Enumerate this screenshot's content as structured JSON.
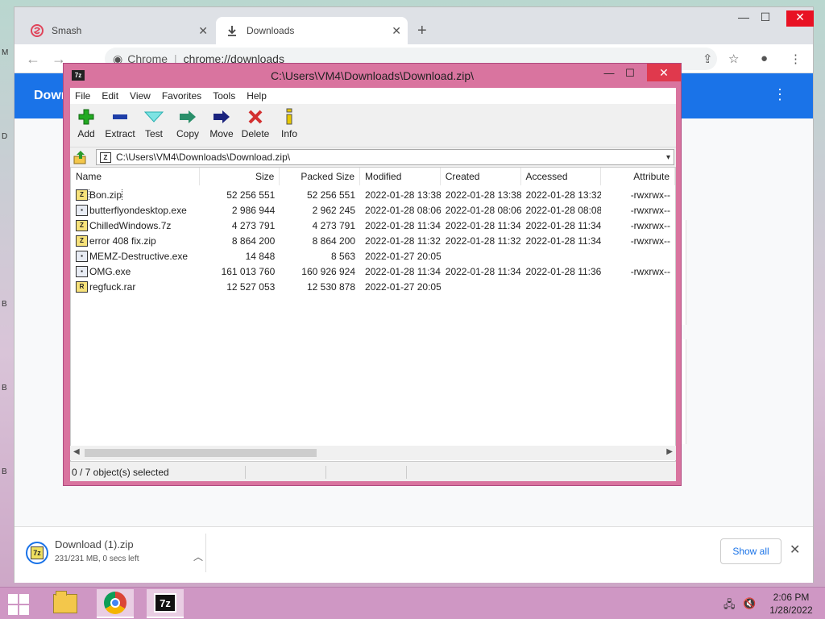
{
  "desktop": {
    "side_letters": [
      "M",
      "D",
      "B",
      "B",
      "B"
    ]
  },
  "browser": {
    "tabs": [
      {
        "label": "Smash",
        "icon": "smash-logo-icon"
      },
      {
        "label": "Downloads",
        "icon": "download-icon"
      }
    ],
    "omnibox": {
      "scheme_label": "Chrome",
      "url": "chrome://downloads"
    },
    "page_title": "Down",
    "shelf": {
      "filename": "Download (1).zip",
      "status": "231/231 MB, 0 secs left",
      "show_all_label": "Show all"
    }
  },
  "sevenzip": {
    "window_title": "C:\\Users\\VM4\\Downloads\\Download.zip\\",
    "menu": [
      "File",
      "Edit",
      "View",
      "Favorites",
      "Tools",
      "Help"
    ],
    "toolbar": [
      {
        "label": "Add",
        "icon": "plus-icon",
        "color": "#22aa22"
      },
      {
        "label": "Extract",
        "icon": "minus-icon",
        "color": "#1f3fa8"
      },
      {
        "label": "Test",
        "icon": "check-icon",
        "color": "#2ab0b0"
      },
      {
        "label": "Copy",
        "icon": "copy-arrow-icon",
        "color": "#2a8f6a"
      },
      {
        "label": "Move",
        "icon": "move-arrow-icon",
        "color": "#1a237e"
      },
      {
        "label": "Delete",
        "icon": "delete-x-icon",
        "color": "#d32f2f"
      },
      {
        "label": "Info",
        "icon": "info-icon",
        "color": "#c8a600"
      }
    ],
    "address": "C:\\Users\\VM4\\Downloads\\Download.zip\\",
    "columns": [
      "Name",
      "Size",
      "Packed Size",
      "Modified",
      "Created",
      "Accessed",
      "Attribute"
    ],
    "files": [
      {
        "name": "Bon.zip",
        "type": "arc",
        "size": "52 256 551",
        "packed": "52 256 551",
        "modified": "2022-01-28 13:38",
        "created": "2022-01-28 13:38",
        "accessed": "2022-01-28 13:32",
        "attr": "-rwxrwx--"
      },
      {
        "name": "butterflyondesktop.exe",
        "type": "exe",
        "size": "2 986 944",
        "packed": "2 962 245",
        "modified": "2022-01-28 08:06",
        "created": "2022-01-28 08:06",
        "accessed": "2022-01-28 08:08",
        "attr": "-rwxrwx--"
      },
      {
        "name": "ChilledWindows.7z",
        "type": "arc",
        "size": "4 273 791",
        "packed": "4 273 791",
        "modified": "2022-01-28 11:34",
        "created": "2022-01-28 11:34",
        "accessed": "2022-01-28 11:34",
        "attr": "-rwxrwx--"
      },
      {
        "name": "error 408 fix.zip",
        "type": "arc",
        "size": "8 864 200",
        "packed": "8 864 200",
        "modified": "2022-01-28 11:32",
        "created": "2022-01-28 11:32",
        "accessed": "2022-01-28 11:34",
        "attr": "-rwxrwx--"
      },
      {
        "name": "MEMZ-Destructive.exe",
        "type": "exe",
        "size": "14 848",
        "packed": "8 563",
        "modified": "2022-01-27 20:05",
        "created": "",
        "accessed": "",
        "attr": ""
      },
      {
        "name": "OMG.exe",
        "type": "exe",
        "size": "161 013 760",
        "packed": "160 926 924",
        "modified": "2022-01-28 11:34",
        "created": "2022-01-28 11:34",
        "accessed": "2022-01-28 11:36",
        "attr": "-rwxrwx--"
      },
      {
        "name": "regfuck.rar",
        "type": "rar",
        "size": "12 527 053",
        "packed": "12 530 878",
        "modified": "2022-01-27 20:05",
        "created": "",
        "accessed": "",
        "attr": ""
      }
    ],
    "status": "0 / 7 object(s) selected"
  },
  "taskbar": {
    "time": "2:06 PM",
    "date": "1/28/2022",
    "sevenzip_label": "7z"
  }
}
